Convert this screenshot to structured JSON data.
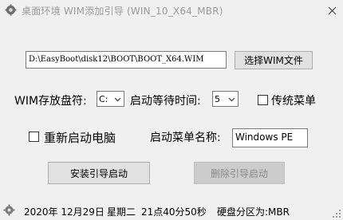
{
  "window": {
    "title": "桌面环境   WIM添加引导   (WIN_10_X64_MBR)"
  },
  "path": {
    "value": "D:\\EasyBoot\\disk12\\BOOT\\BOOT_X64.WIM",
    "browse_label": "选择WIM文件"
  },
  "options": {
    "drive_label": "WIM存放盘符:",
    "drive_value": "C:",
    "timeout_label": "启动等待时间:",
    "timeout_value": "5",
    "traditional_menu_label": "传统菜单",
    "restart_label": "重新启动电脑",
    "menu_name_label": "启动菜单名称:",
    "menu_name_value": "Windows PE"
  },
  "actions": {
    "install_label": "安装引导启动",
    "delete_label": "删除引导启动"
  },
  "status": {
    "date": "2020年 12月29日",
    "weekday": "星期二",
    "time": "21点40分50秒",
    "partition": "硬盘分区为:MBR"
  }
}
